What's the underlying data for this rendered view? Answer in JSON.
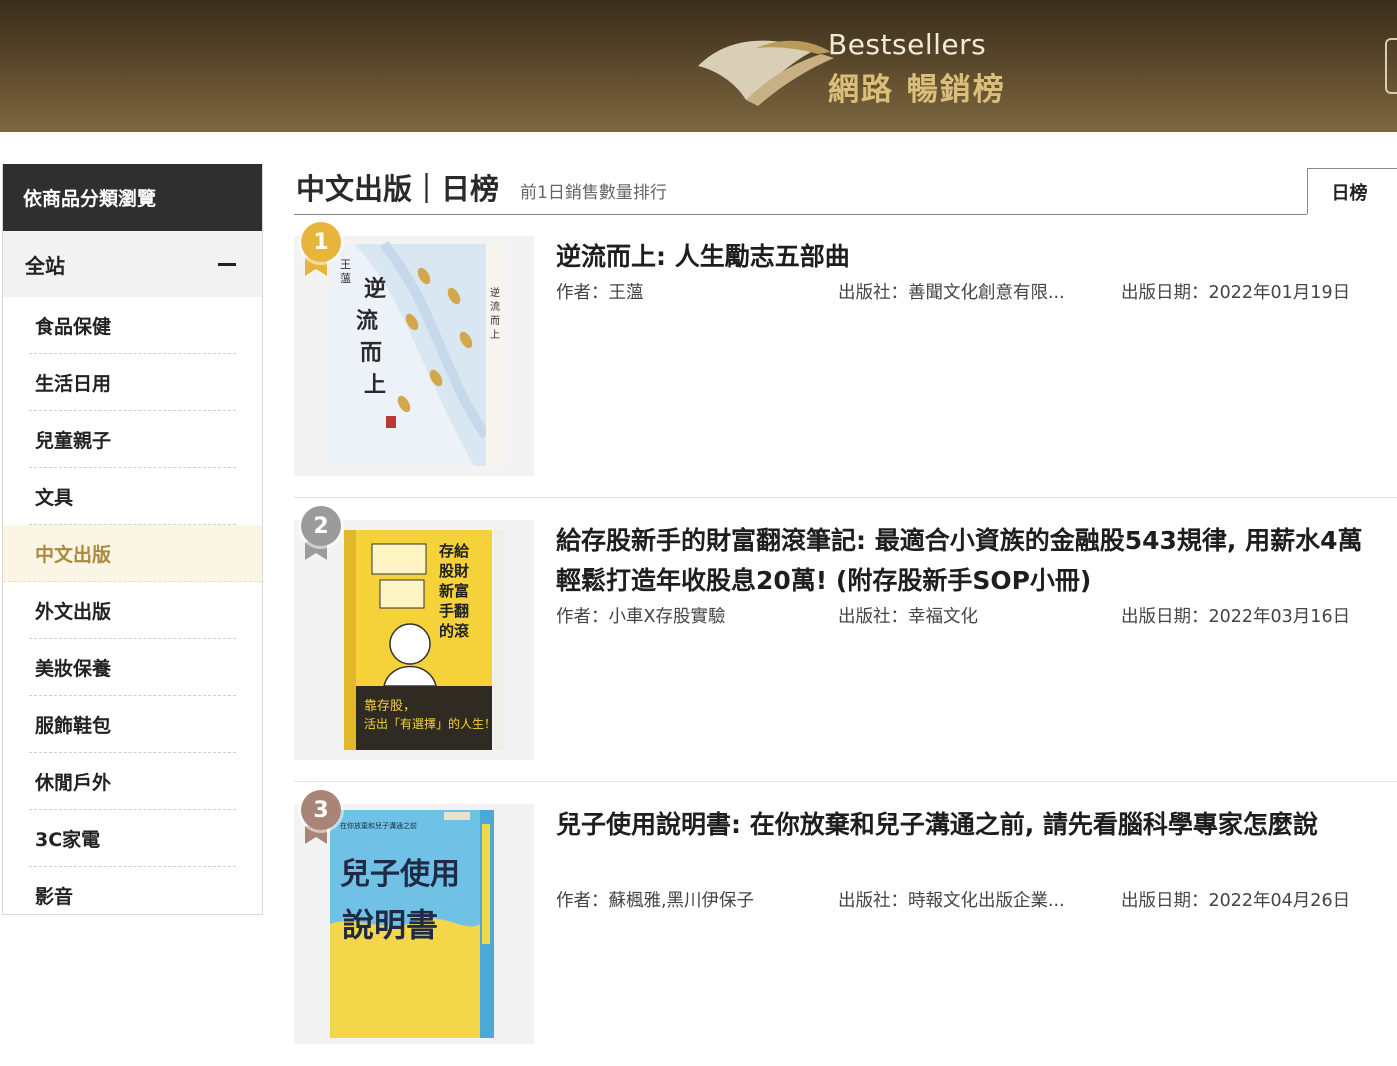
{
  "header": {
    "title_en": "Bestsellers",
    "title_zh": "網路 暢銷榜"
  },
  "sidebar": {
    "heading": "依商品分類瀏覽",
    "all_label": "全站",
    "categories": [
      {
        "label": "食品保健"
      },
      {
        "label": "生活日用"
      },
      {
        "label": "兒童親子"
      },
      {
        "label": "文具"
      },
      {
        "label": "中文出版",
        "active": true
      },
      {
        "label": "外文出版"
      },
      {
        "label": "美妝保養"
      },
      {
        "label": "服飾鞋包"
      },
      {
        "label": "休閒戶外"
      },
      {
        "label": "3C家電"
      },
      {
        "label": "影音"
      }
    ]
  },
  "main": {
    "title": "中文出版｜日榜",
    "subtitle": "前1日銷售數量排行",
    "tab_label": "日榜",
    "items": [
      {
        "rank": "1",
        "title": "逆流而上: 人生勵志五部曲",
        "author": "作者：王薀",
        "publisher": "出版社：善聞文化創意有限...",
        "date": "出版日期：2022年01月19日",
        "cover_text": "逆流而上",
        "cover_author": "王薀"
      },
      {
        "rank": "2",
        "title": "給存股新手的財富翻滾筆記: 最適合小資族的金融股543規律, 用薪水4萬輕鬆打造年收股息20萬! (附存股新手SOP小冊)",
        "author": "作者：小車X存股實驗",
        "publisher": "出版社：幸福文化",
        "date": "出版日期：2022年03月16日",
        "cover_text": "給存股新手的財富翻滾筆記",
        "cover_bottom": "靠存股，活出「有選擇」的人生！"
      },
      {
        "rank": "3",
        "title": "兒子使用說明書: 在你放棄和兒子溝通之前, 請先看腦科學專家怎麼說",
        "author": "作者：蘇楓雅,黑川伊保子",
        "publisher": "出版社：時報文化出版企業...",
        "date": "出版日期：2022年04月26日",
        "cover_text": "兒子使用說明書"
      }
    ]
  },
  "colors": {
    "gold": "#e8b53c",
    "silver": "#9b9b9b",
    "bronze": "#a88576",
    "active_category": "#a98a3c"
  }
}
